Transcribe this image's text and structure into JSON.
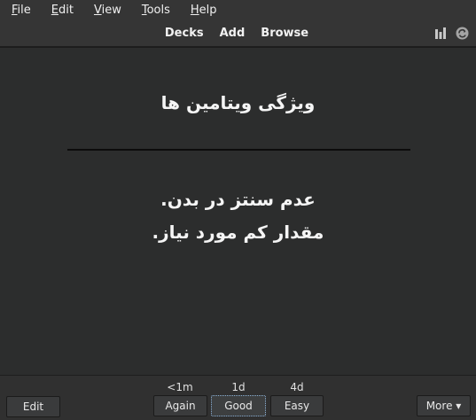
{
  "menubar": {
    "items": [
      {
        "label": "File"
      },
      {
        "label": "Edit"
      },
      {
        "label": "View"
      },
      {
        "label": "Tools"
      },
      {
        "label": "Help"
      }
    ]
  },
  "toolbar": {
    "links": [
      "Decks",
      "Add",
      "Browse"
    ],
    "right_icons": [
      "stats-icon",
      "sync-icon"
    ],
    "sync_color": "#a4a4a4"
  },
  "card": {
    "front": "ویژگی ویتامین ها",
    "back_lines": [
      "عدم سنتز در بدن.",
      "مقدار کم مورد نیاز."
    ]
  },
  "bottombar": {
    "edit_label": "Edit",
    "answers": [
      {
        "interval": "<1m",
        "label": "Again"
      },
      {
        "interval": "1d",
        "label": "Good"
      },
      {
        "interval": "4d",
        "label": "Easy"
      }
    ],
    "more_label": "More ▾"
  }
}
